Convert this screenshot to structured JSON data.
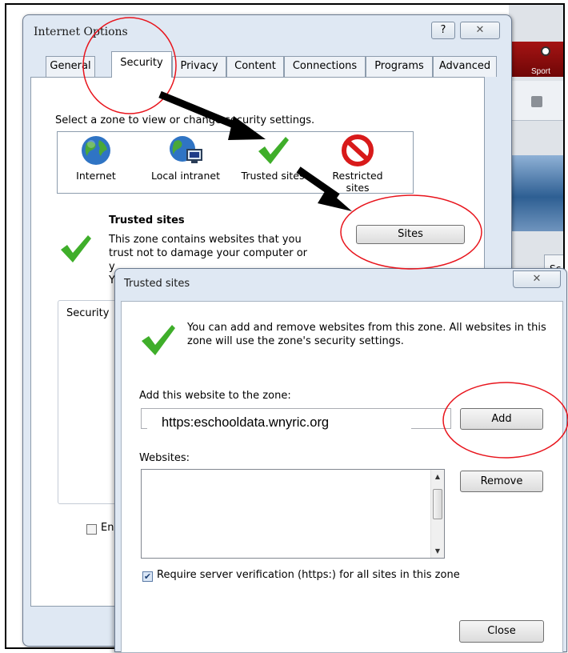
{
  "background_window": {
    "tab_label": "Sport",
    "partial_tab": "Sc"
  },
  "internet_options": {
    "title": "Internet Options",
    "help_icon_glyph": "?",
    "close_icon_glyph": "✕",
    "tabs": [
      {
        "label": "General"
      },
      {
        "label": "Security",
        "active": true
      },
      {
        "label": "Privacy"
      },
      {
        "label": "Content"
      },
      {
        "label": "Connections"
      },
      {
        "label": "Programs"
      },
      {
        "label": "Advanced"
      }
    ],
    "zone_prompt": "Select a zone to view or change security settings.",
    "zones": [
      {
        "label": "Internet",
        "icon": "globe-icon"
      },
      {
        "label": "Local intranet",
        "icon": "intranet-icon"
      },
      {
        "label": "Trusted sites",
        "icon": "checkmark-icon"
      },
      {
        "label": "Restricted",
        "label2": "sites",
        "icon": "prohibited-icon"
      }
    ],
    "selected_zone_title": "Trusted sites",
    "selected_zone_desc_1": "This zone contains websites that you",
    "selected_zone_desc_2": "trust not to damage your computer or",
    "selected_zone_desc_3": "y",
    "selected_zone_desc_4": "Y",
    "sites_button": "Sites",
    "security_group_label": "Security",
    "enable_checkbox_label": "En"
  },
  "trusted_sites_dialog": {
    "title": "Trusted sites",
    "close_icon_glyph": "✕",
    "info_text": "You can add and remove websites from this zone. All websites in this zone will use the zone's security settings.",
    "add_label": "Add this website to the zone:",
    "add_value": "https:eschooldata.wnyric.org",
    "add_button": "Add",
    "websites_label": "Websites:",
    "websites": [],
    "remove_button": "Remove",
    "require_https_label": "Require server verification (https:) for all sites in this zone",
    "require_https_checked": true,
    "close_button": "Close"
  },
  "colors": {
    "annotation_red": "#e8141c",
    "arrow": "#000000",
    "check_green": "#3fae2a"
  }
}
